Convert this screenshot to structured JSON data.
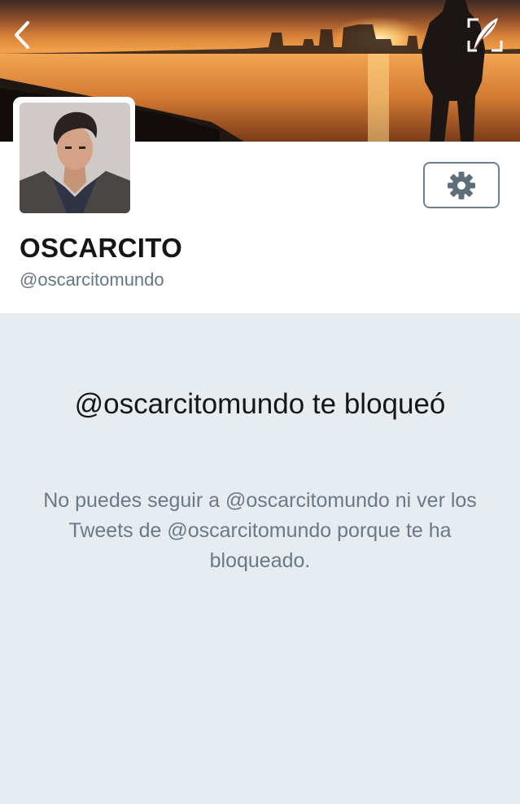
{
  "header": {
    "back_icon": "chevron-left-icon",
    "compose_icon": "compose-tweet-icon"
  },
  "profile": {
    "display_name": "OSCARCITO",
    "handle": "@oscarcitomundo",
    "settings_icon": "gear-icon"
  },
  "blocked_notice": {
    "title": "@oscarcitomundo te bloqueó",
    "description": "No puedes seguir a @oscarcitomundo ni ver los Tweets de @oscarcitomundo porque te ha bloqueado."
  },
  "colors": {
    "background": "#e6ecf0",
    "name": "#14171a",
    "secondary_text": "#657786",
    "settings_border": "#6f7f8c"
  }
}
